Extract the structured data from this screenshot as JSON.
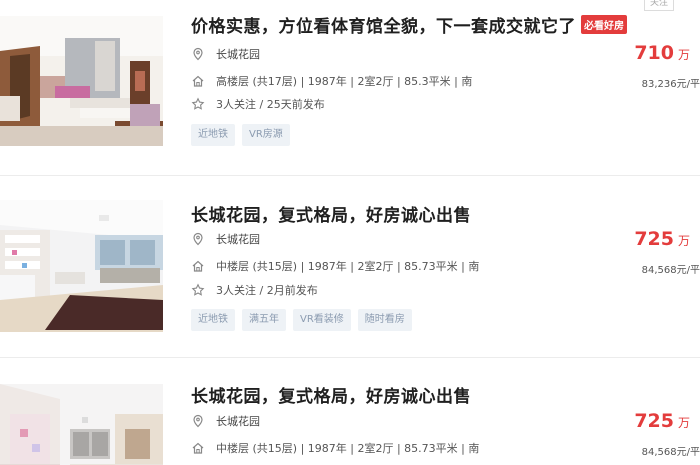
{
  "follow_label": "关注",
  "listings": [
    {
      "title": "价格实惠，方位看体育馆全貌，下一套成交就它了",
      "badge": "必看好房",
      "community": "长城花园",
      "house_info": "高楼层 (共17层) | 1987年 | 2室2厅 | 85.3平米 | 南",
      "follow_info": "3人关注 / 25天前发布",
      "tags": [
        "近地铁",
        "VR房源"
      ],
      "total_price": "710",
      "price_unit": "万",
      "unit_price": "83,236元/平"
    },
    {
      "title": "长城花园，复式格局，好房诚心出售",
      "community": "长城花园",
      "house_info": "中楼层 (共15层) | 1987年 | 2室2厅 | 85.73平米 | 南",
      "follow_info": "3人关注 / 2月前发布",
      "tags": [
        "近地铁",
        "满五年",
        "VR看装修",
        "随时看房"
      ],
      "total_price": "725",
      "price_unit": "万",
      "unit_price": "84,568元/平"
    },
    {
      "title": "长城花园，复式格局，好房诚心出售",
      "community": "长城花园",
      "house_info": "中楼层 (共15层) | 1987年 | 2室2厅 | 85.73平米 | 南",
      "total_price": "725",
      "price_unit": "万",
      "unit_price": "84,568元/平"
    }
  ]
}
